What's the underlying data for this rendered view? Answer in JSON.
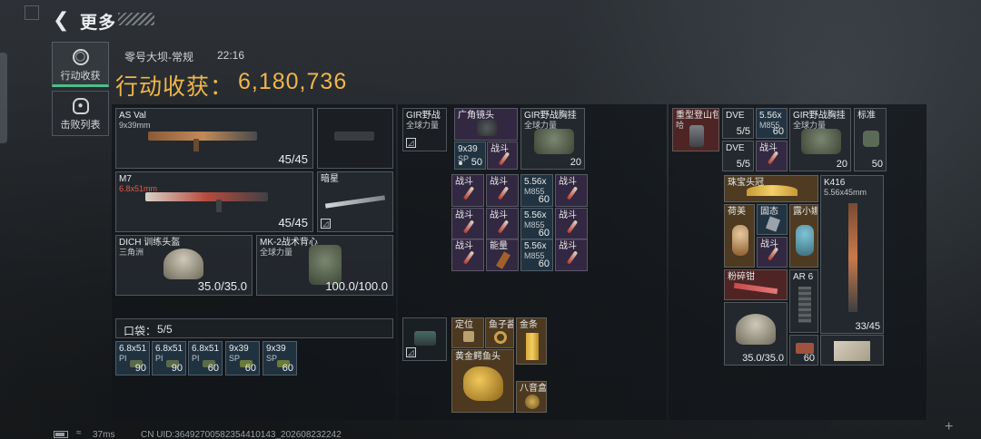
{
  "header": {
    "title": "更多",
    "back_icon": "back-arrow-icon"
  },
  "sidebar": {
    "tabs": [
      {
        "label": "行动收获",
        "icon": "loot-icon",
        "active": true
      },
      {
        "label": "击败列表",
        "icon": "skull-icon",
        "active": false
      }
    ]
  },
  "session": {
    "map": "零号大坝-常规",
    "time": "22:16"
  },
  "gain": {
    "label": "行动收获：",
    "value": "6,180,736"
  },
  "loadout": {
    "primary": {
      "name": "AS Val",
      "caliber": "9x39mm",
      "ammo": "45/45"
    },
    "secondary": {
      "name": "M7",
      "caliber": "6.8x51mm",
      "ammo": "45/45"
    },
    "melee": {
      "name": "暗星"
    },
    "helmet": {
      "name": "DICH 训练头盔",
      "sub": "三角洲",
      "durability": "35.0/35.0"
    },
    "armor": {
      "name": "MK-2战术背心",
      "sub": "全球力量",
      "durability": "100.0/100.0"
    }
  },
  "pocket": {
    "label": "口袋：",
    "count": "5/5",
    "items": [
      {
        "name": "6.8x51",
        "sub": "PI",
        "count": "90"
      },
      {
        "name": "6.8x51",
        "sub": "PI",
        "count": "90"
      },
      {
        "name": "6.8x51",
        "sub": "PI",
        "count": "60"
      },
      {
        "name": "9x39",
        "sub": "SP",
        "count": "60"
      },
      {
        "name": "9x39",
        "sub": "SP",
        "count": "60"
      }
    ]
  },
  "chest_rig": {
    "items": [
      {
        "name": "GIR野战",
        "sub": "全球力量"
      },
      {
        "name": "广角镜头",
        "sub": ""
      },
      {
        "name": "GIR野战胸挂",
        "sub": "全球力量",
        "count": "20"
      },
      {
        "name": "9x39",
        "sub": "SP",
        "count": "50"
      },
      {
        "name": "战斗",
        "sub": ""
      }
    ]
  },
  "backpack": {
    "rows": [
      [
        "战斗",
        "战斗",
        "5.56x",
        "战斗"
      ],
      [
        "战斗",
        "战斗",
        "5.56x",
        "战斗"
      ],
      [
        "战斗",
        "能量",
        "5.56x",
        "战斗"
      ]
    ],
    "counts": [
      "60",
      "60",
      "60"
    ],
    "sub": "M855"
  },
  "safe_box": {
    "items": [
      {
        "name": "定位"
      },
      {
        "name": "鱼子酱"
      },
      {
        "name": "金条"
      },
      {
        "name": "黄金鳄鱼头"
      },
      {
        "name": "八音盒"
      }
    ]
  },
  "right_storage": {
    "items": [
      {
        "name": "重型登山包",
        "sub": "哈"
      },
      {
        "name": "DVE",
        "count": "5/5"
      },
      {
        "name": "5.56x",
        "sub": "M855",
        "count": "60"
      },
      {
        "name": "GIR野战胸挂",
        "sub": "全球力量",
        "count": "20"
      },
      {
        "name": "标准",
        "count": "50"
      },
      {
        "name": "DVE",
        "count": "5/5"
      },
      {
        "name": "战斗"
      },
      {
        "name": "珠宝头冠"
      },
      {
        "name": "K416",
        "sub": "5.56x45mm",
        "count": "33/45"
      },
      {
        "name": "荷美"
      },
      {
        "name": "固态"
      },
      {
        "name": "露小娜"
      },
      {
        "name": "战斗"
      },
      {
        "name": "粉碎钳"
      },
      {
        "name": "AR 6"
      },
      {
        "name": "helmet",
        "count": "35.0/35.0"
      },
      {
        "name": "ammo-box",
        "count": "60"
      }
    ]
  },
  "footer": {
    "ping": "37ms",
    "uid": "CN UID:36492700582354410143_202608232242"
  },
  "colors": {
    "accent_gold": "#efb64a",
    "active_tab": "#4bbf8d"
  }
}
